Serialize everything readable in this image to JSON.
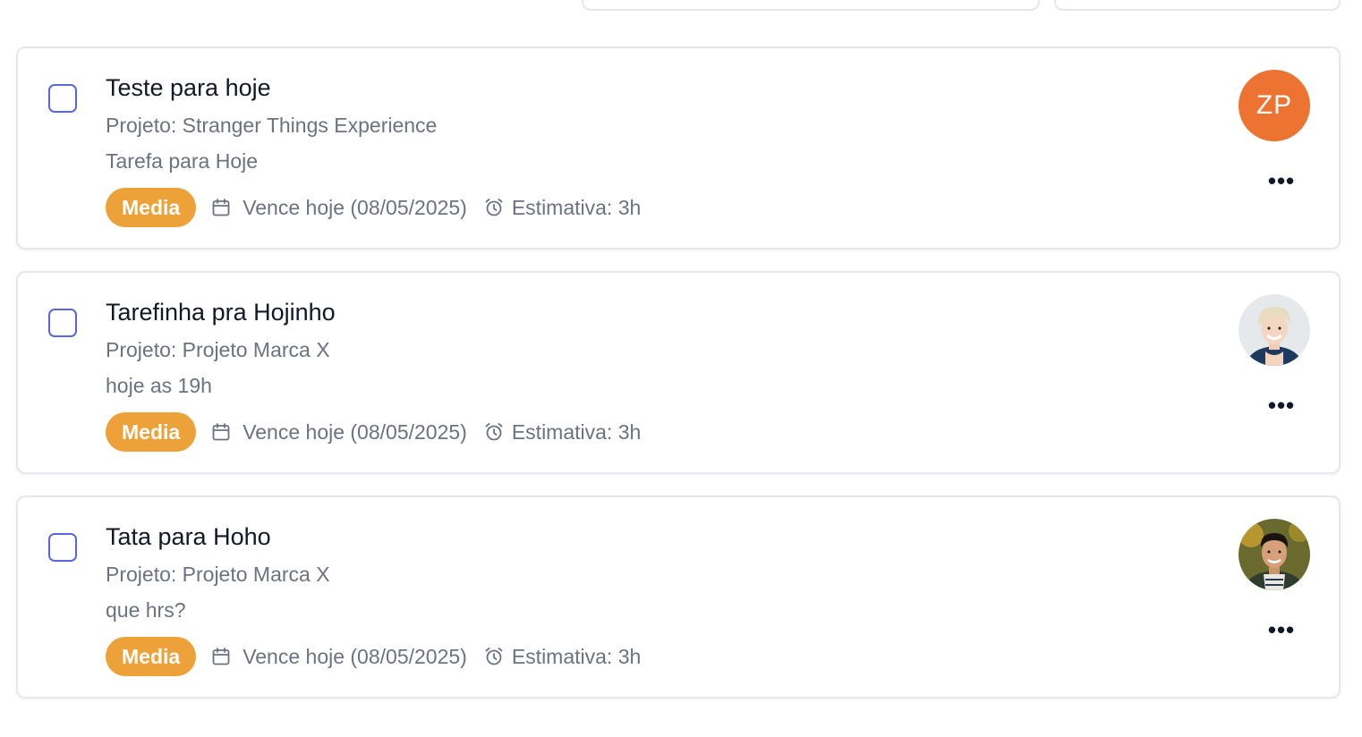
{
  "tasks": [
    {
      "title": "Teste para hoje",
      "project": "Projeto: Stranger Things Experience",
      "description": "Tarefa para Hoje",
      "priority": "Media",
      "due": "Vence hoje (08/05/2025)",
      "estimate": "Estimativa: 3h",
      "assignee_initials": "ZP",
      "completed": false
    },
    {
      "title": "Tarefinha pra Hojinho",
      "project": "Projeto: Projeto Marca X",
      "description": "hoje as 19h",
      "priority": "Media",
      "due": "Vence hoje (08/05/2025)",
      "estimate": "Estimativa: 3h",
      "assignee_photo": "woman-short-blonde-hair",
      "completed": false
    },
    {
      "title": "Tata para Hoho",
      "project": "Projeto: Projeto Marca X",
      "description": "que hrs?",
      "priority": "Media",
      "due": "Vence hoje (08/05/2025)",
      "estimate": "Estimativa: 3h",
      "assignee_photo": "man-dark-hair-outdoors",
      "completed": false
    }
  ],
  "icons": {
    "due": "calendar-icon",
    "estimate": "alarm-clock-icon",
    "more": "more-horizontal-icon",
    "more_glyph": "•••"
  },
  "colors": {
    "priority_media": "#eca238",
    "checkbox_border": "#5b67d8",
    "initials_avatar": "#ec7332"
  }
}
